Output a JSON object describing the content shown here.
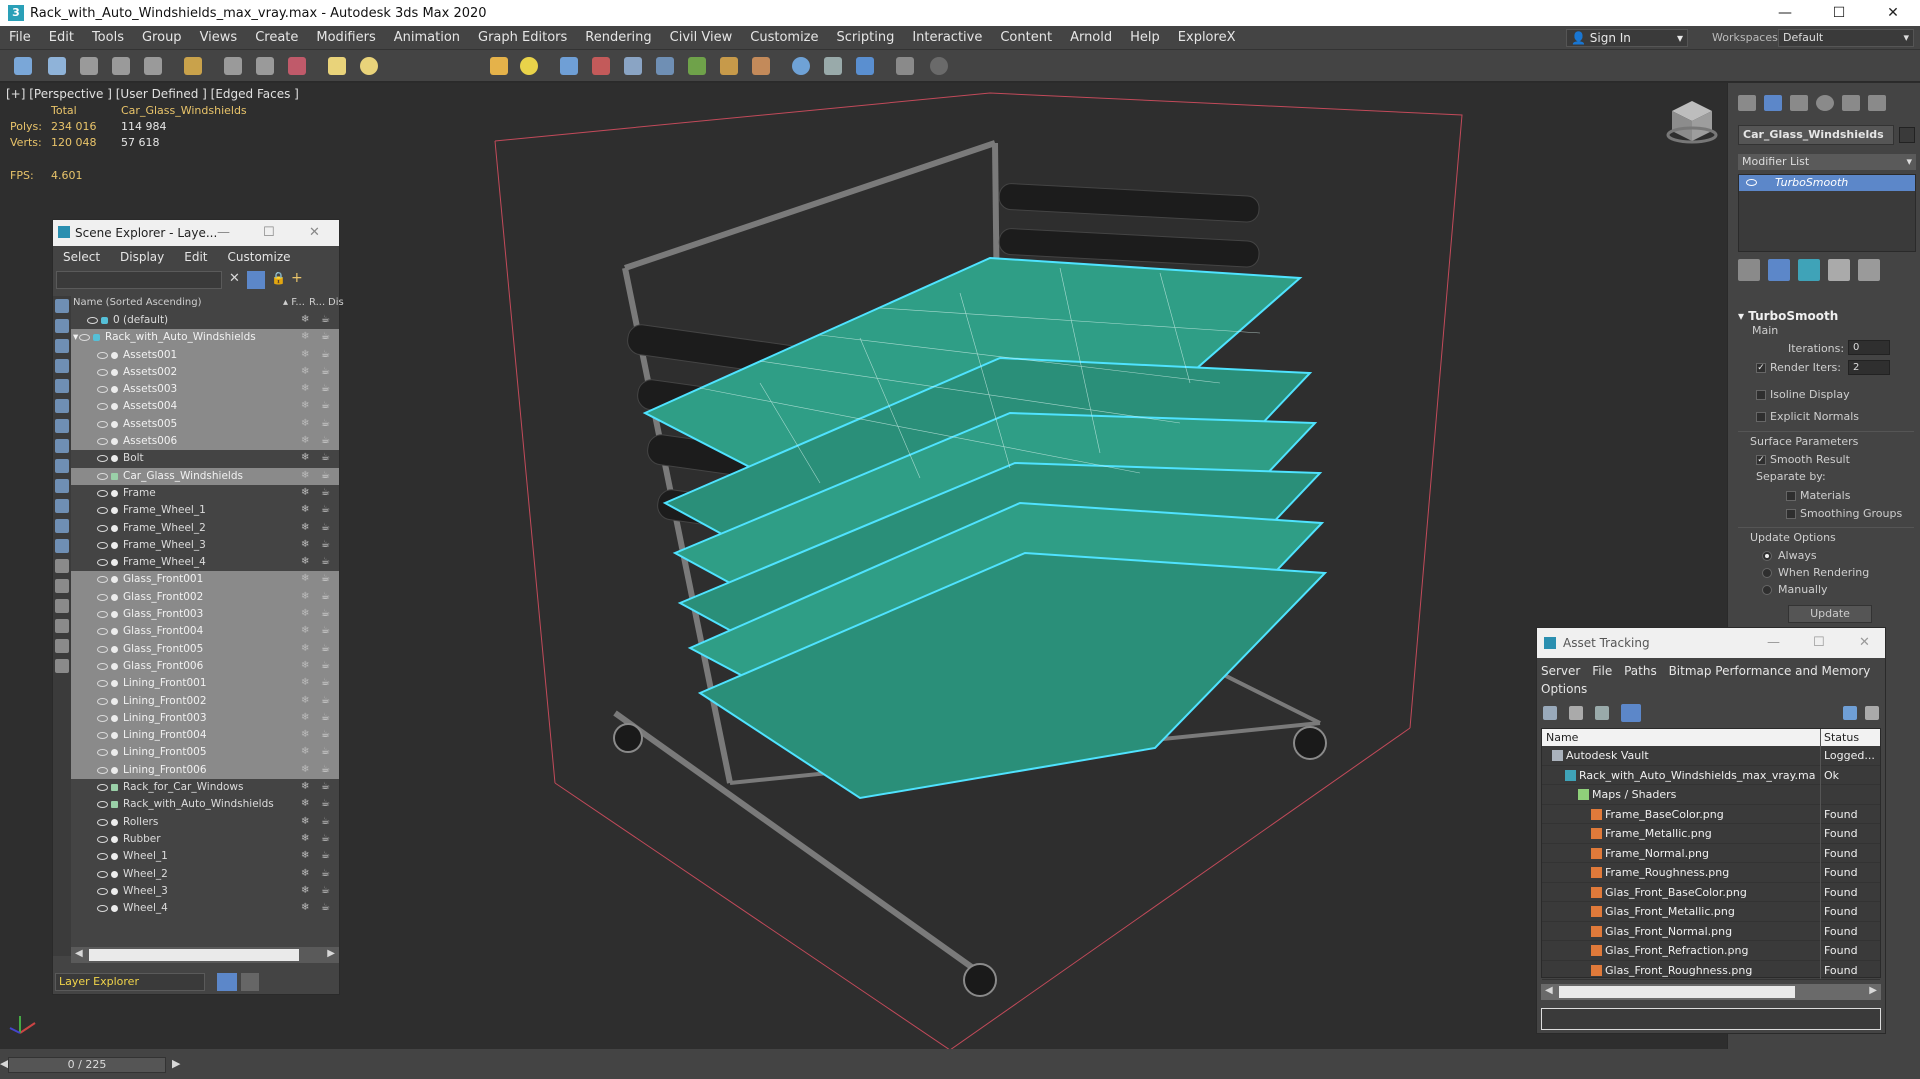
{
  "window": {
    "title": "Rack_with_Auto_Windshields_max_vray.max - Autodesk 3ds Max 2020",
    "app_icon": "3",
    "minimize": "—",
    "maximize": "☐",
    "close": "✕"
  },
  "menu": [
    "File",
    "Edit",
    "Tools",
    "Group",
    "Views",
    "Create",
    "Modifiers",
    "Animation",
    "Graph Editors",
    "Rendering",
    "Civil View",
    "Customize",
    "Scripting",
    "Interactive",
    "Content",
    "Arnold",
    "Help",
    "ExploreX"
  ],
  "account": {
    "sign_in": "Sign In",
    "workspaces_label": "Workspaces:",
    "workspace": "Default"
  },
  "viewport": {
    "label": "[+] [Perspective ] [User Defined ] [Edged Faces ]",
    "stats": {
      "total_label": "Total",
      "object_label": "Car_Glass_Windshields",
      "polys_label": "Polys:",
      "polys_total": "234 016",
      "polys_obj": "114 984",
      "verts_label": "Verts:",
      "verts_total": "120 048",
      "verts_obj": "57 618",
      "fps_label": "FPS:",
      "fps": "4.601"
    }
  },
  "scene_explorer": {
    "title": "Scene Explorer - Laye...",
    "menu": [
      "Select",
      "Display",
      "Edit",
      "Customize"
    ],
    "col_name": "Name (Sorted Ascending)",
    "col_f": "▴ F...",
    "col_r": "R...",
    "col_d": "Dis",
    "rows": [
      {
        "name": "0 (default)",
        "indent": 1,
        "type": "layer",
        "selected": false
      },
      {
        "name": "Rack_with_Auto_Windshields",
        "indent": 0,
        "type": "layer",
        "selected": true
      },
      {
        "name": "Assets001",
        "indent": 2,
        "type": "obj",
        "selected": true
      },
      {
        "name": "Assets002",
        "indent": 2,
        "type": "obj",
        "selected": true
      },
      {
        "name": "Assets003",
        "indent": 2,
        "type": "obj",
        "selected": true
      },
      {
        "name": "Assets004",
        "indent": 2,
        "type": "obj",
        "selected": true
      },
      {
        "name": "Assets005",
        "indent": 2,
        "type": "obj",
        "selected": true
      },
      {
        "name": "Assets006",
        "indent": 2,
        "type": "obj",
        "selected": true
      },
      {
        "name": "Bolt",
        "indent": 2,
        "type": "obj",
        "selected": false
      },
      {
        "name": "Car_Glass_Windshields",
        "indent": 2,
        "type": "group",
        "selected": true
      },
      {
        "name": "Frame",
        "indent": 2,
        "type": "obj",
        "selected": false
      },
      {
        "name": "Frame_Wheel_1",
        "indent": 2,
        "type": "obj",
        "selected": false
      },
      {
        "name": "Frame_Wheel_2",
        "indent": 2,
        "type": "obj",
        "selected": false
      },
      {
        "name": "Frame_Wheel_3",
        "indent": 2,
        "type": "obj",
        "selected": false
      },
      {
        "name": "Frame_Wheel_4",
        "indent": 2,
        "type": "obj",
        "selected": false
      },
      {
        "name": "Glass_Front001",
        "indent": 2,
        "type": "obj",
        "selected": true
      },
      {
        "name": "Glass_Front002",
        "indent": 2,
        "type": "obj",
        "selected": true
      },
      {
        "name": "Glass_Front003",
        "indent": 2,
        "type": "obj",
        "selected": true
      },
      {
        "name": "Glass_Front004",
        "indent": 2,
        "type": "obj",
        "selected": true
      },
      {
        "name": "Glass_Front005",
        "indent": 2,
        "type": "obj",
        "selected": true
      },
      {
        "name": "Glass_Front006",
        "indent": 2,
        "type": "obj",
        "selected": true
      },
      {
        "name": "Lining_Front001",
        "indent": 2,
        "type": "obj",
        "selected": true
      },
      {
        "name": "Lining_Front002",
        "indent": 2,
        "type": "obj",
        "selected": true
      },
      {
        "name": "Lining_Front003",
        "indent": 2,
        "type": "obj",
        "selected": true
      },
      {
        "name": "Lining_Front004",
        "indent": 2,
        "type": "obj",
        "selected": true
      },
      {
        "name": "Lining_Front005",
        "indent": 2,
        "type": "obj",
        "selected": true
      },
      {
        "name": "Lining_Front006",
        "indent": 2,
        "type": "obj",
        "selected": true
      },
      {
        "name": "Rack_for_Car_Windows",
        "indent": 2,
        "type": "group",
        "selected": false
      },
      {
        "name": "Rack_with_Auto_Windshields",
        "indent": 2,
        "type": "group",
        "selected": false
      },
      {
        "name": "Rollers",
        "indent": 2,
        "type": "obj",
        "selected": false
      },
      {
        "name": "Rubber",
        "indent": 2,
        "type": "obj",
        "selected": false
      },
      {
        "name": "Wheel_1",
        "indent": 2,
        "type": "obj",
        "selected": false
      },
      {
        "name": "Wheel_2",
        "indent": 2,
        "type": "obj",
        "selected": false
      },
      {
        "name": "Wheel_3",
        "indent": 2,
        "type": "obj",
        "selected": false
      },
      {
        "name": "Wheel_4",
        "indent": 2,
        "type": "obj",
        "selected": false
      }
    ],
    "bottom_label": "Layer Explorer"
  },
  "command_panel": {
    "object_name": "Car_Glass_Windshields",
    "modifier_list": "Modifier List",
    "stack_item": "TurboSmooth",
    "rollout_title": "TurboSmooth",
    "main_label": "Main",
    "iterations_label": "Iterations:",
    "iterations": "0",
    "render_iters_label": "Render Iters:",
    "render_iters": "2",
    "render_iters_checked": true,
    "isoline": "Isoline Display",
    "explicit_normals": "Explicit Normals",
    "surface_params": "Surface Parameters",
    "smooth_result": "Smooth Result",
    "smooth_result_checked": true,
    "separate_by": "Separate by:",
    "materials": "Materials",
    "smoothing_groups": "Smoothing Groups",
    "update_options": "Update Options",
    "always": "Always",
    "when_rendering": "When Rendering",
    "manually": "Manually",
    "update_button": "Update"
  },
  "asset_tracking": {
    "title": "Asset Tracking",
    "menu": [
      "Server",
      "File",
      "Paths",
      "Bitmap Performance and Memory"
    ],
    "menu2": "Options",
    "col_name": "Name",
    "col_status": "Status",
    "rows": [
      {
        "name": "Autodesk Vault",
        "status": "Logged...",
        "indent": 0,
        "icon": "vault"
      },
      {
        "name": "Rack_with_Auto_Windshields_max_vray.max",
        "status": "Ok",
        "indent": 1,
        "icon": "max"
      },
      {
        "name": "Maps / Shaders",
        "status": "",
        "indent": 2,
        "icon": "folder"
      },
      {
        "name": "Frame_BaseColor.png",
        "status": "Found",
        "indent": 3,
        "icon": "image"
      },
      {
        "name": "Frame_Metallic.png",
        "status": "Found",
        "indent": 3,
        "icon": "image"
      },
      {
        "name": "Frame_Normal.png",
        "status": "Found",
        "indent": 3,
        "icon": "image"
      },
      {
        "name": "Frame_Roughness.png",
        "status": "Found",
        "indent": 3,
        "icon": "image"
      },
      {
        "name": "Glas_Front_BaseColor.png",
        "status": "Found",
        "indent": 3,
        "icon": "image"
      },
      {
        "name": "Glas_Front_Metallic.png",
        "status": "Found",
        "indent": 3,
        "icon": "image"
      },
      {
        "name": "Glas_Front_Normal.png",
        "status": "Found",
        "indent": 3,
        "icon": "image"
      },
      {
        "name": "Glas_Front_Refraction.png",
        "status": "Found",
        "indent": 3,
        "icon": "image"
      },
      {
        "name": "Glas_Front_Roughness.png",
        "status": "Found",
        "indent": 3,
        "icon": "image"
      }
    ]
  },
  "timeline": {
    "frame": "0 / 225"
  },
  "colors": {
    "selection_cyan": "#4fe3ff",
    "glass_teal": "#2f9e86",
    "stat_yellow": "#e9c46a",
    "bbox_pink": "#c24a5a"
  }
}
